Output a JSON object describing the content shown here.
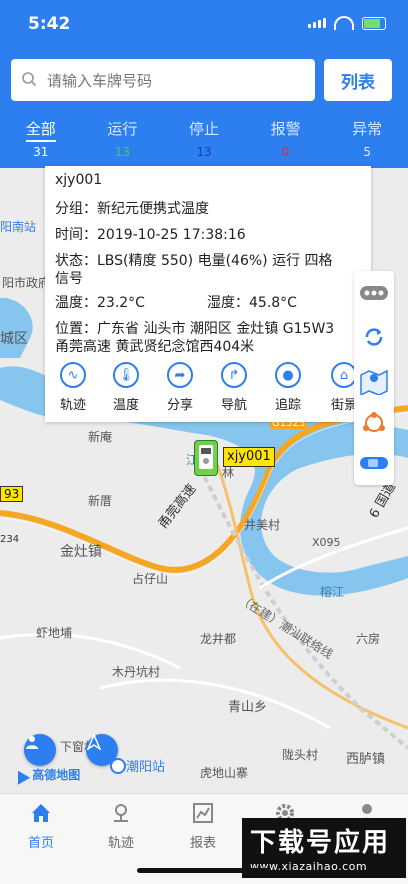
{
  "status_bar": {
    "time": "5:42"
  },
  "search": {
    "placeholder": "请输入车牌号码",
    "list_label": "列表"
  },
  "tabs": [
    {
      "label": "全部",
      "count": "31",
      "color": "#ffffff"
    },
    {
      "label": "运行",
      "count": "13",
      "color": "#3fd24a"
    },
    {
      "label": "停止",
      "count": "13",
      "color": "#1a3cc8"
    },
    {
      "label": "报警",
      "count": "0",
      "color": "#e02a2a"
    },
    {
      "label": "异常",
      "count": "5",
      "color": "#d7e7ff"
    }
  ],
  "popup": {
    "plate": "xjy001",
    "group_label": "分组：",
    "group": "新纪元便携式温度",
    "time_label": "时间：",
    "time": "2019-10-25 17:38:16",
    "state_label": "状态：",
    "state_line1": "LBS(精度 550) 电量(46%) 运行 四格",
    "state_line2": "信号",
    "temp_label": "温度：",
    "temp": "23.2°C",
    "humidity_label": "湿度：",
    "humidity": "45.8°C",
    "location_label": "位置：",
    "location_line1": "广东省 汕头市 潮阳区 金灶镇 G15W3",
    "location_line2": "甬莞高速 黄武贤纪念馆西404米",
    "actions": [
      {
        "label": "轨迹",
        "icon": "track-icon"
      },
      {
        "label": "温度",
        "icon": "thermometer-icon"
      },
      {
        "label": "分享",
        "icon": "share-icon"
      },
      {
        "label": "导航",
        "icon": "navigation-icon"
      },
      {
        "label": "追踪",
        "icon": "tracking-icon"
      },
      {
        "label": "街景",
        "icon": "street-view-icon"
      }
    ]
  },
  "map": {
    "vehicle_label": "xjy001",
    "labels": {
      "nanzhan": "阳南站",
      "zhengfu": "阳市政府",
      "chengqu": "城区",
      "xinan": "新庵",
      "xinxu": "新厝",
      "jinzao": "金灶镇",
      "zhanzai": "占仔山",
      "jingmei": "井美村",
      "x095": "X095",
      "rongjiang": "榕江",
      "xiadipu": "虾地埔",
      "longjingdu": "龙井都",
      "liufang": "六房",
      "muduokeng": "木丹坑村",
      "qingshan": "青山乡",
      "xiachuang": "下窗村",
      "chaoyang": "潮阳站",
      "longtou": "陇头村",
      "xilu": "西胪镇",
      "hudi": "虎地山寨",
      "road93": "93",
      "road234": "234",
      "expressway": "甬莞高速",
      "g1523": "G1523",
      "guodao": "6 国道",
      "chaoshan": "（在建）潮汕联络线",
      "jiang": "江",
      "lin": "林"
    },
    "attribution": "高德地图"
  },
  "nav": [
    {
      "label": "首页",
      "icon": "home-icon",
      "active": true
    },
    {
      "label": "轨迹",
      "icon": "track-pin-icon",
      "active": false
    },
    {
      "label": "报表",
      "icon": "report-icon",
      "active": false
    },
    {
      "label": "设置",
      "icon": "gear-icon",
      "active": false
    },
    {
      "label": "我的",
      "icon": "user-icon",
      "active": false
    }
  ],
  "watermark": {
    "big": "下载号应用",
    "small": "www.xiazaihao.com"
  },
  "colors": {
    "primary": "#2d7ff0",
    "road_orange": "#f5a623",
    "river": "#7cc0ec",
    "highway_label": "#ffe600"
  }
}
